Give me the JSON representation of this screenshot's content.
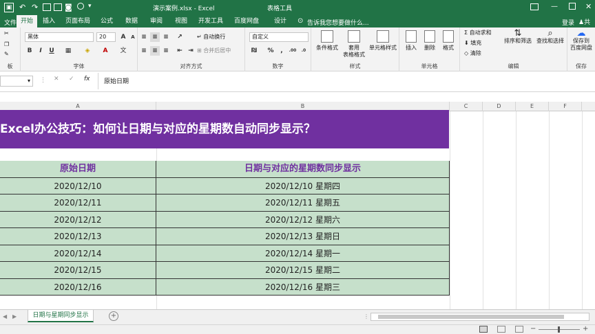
{
  "title_bar": {
    "window_title": "演示案例.xlsx - Excel",
    "context_tab": "表格工具"
  },
  "tabs": {
    "items": [
      "开始",
      "插入",
      "页面布局",
      "公式",
      "数据",
      "审阅",
      "视图",
      "开发工具",
      "百度网盘",
      "设计"
    ],
    "search_placeholder": "告诉我您想要做什么...",
    "login": "登录",
    "share": "共"
  },
  "ribbon": {
    "font_name": "黑体",
    "font_size": "20",
    "number_format": "自定义",
    "wrap_text": "自动换行",
    "merge_center": "合并后居中",
    "conditional_format": "条件格式",
    "table_format": "套用\n表格格式",
    "cell_style": "单元格样式",
    "insert": "插入",
    "delete": "删除",
    "format": "格式",
    "autosum": "自动求和",
    "fill": "填充",
    "clear": "清除",
    "sort_filter": "排序和筛选",
    "find_select": "查找和选择",
    "save_to": "保存到\n百度网盘",
    "groups": [
      "板",
      "字体",
      "对齐方式",
      "数字",
      "样式",
      "单元格",
      "编辑",
      "保存"
    ]
  },
  "formula_bar": {
    "name_box": "",
    "formula": "原始日期"
  },
  "columns": [
    "A",
    "B",
    "C",
    "D",
    "E",
    "F"
  ],
  "sheet": {
    "banner": "Excel办公技巧：如何让日期与对应的星期数自动同步显示？",
    "header_a": "原始日期",
    "header_b": "日期与对应的星期数同步显示",
    "rows": [
      {
        "a": "2020/12/10",
        "b": "2020/12/10  星期四"
      },
      {
        "a": "2020/12/11",
        "b": "2020/12/11  星期五"
      },
      {
        "a": "2020/12/12",
        "b": "2020/12/12  星期六"
      },
      {
        "a": "2020/12/13",
        "b": "2020/12/13  星期日"
      },
      {
        "a": "2020/12/14",
        "b": "2020/12/14  星期一"
      },
      {
        "a": "2020/12/15",
        "b": "2020/12/15  星期二"
      },
      {
        "a": "2020/12/16",
        "b": "2020/12/16  星期三"
      }
    ]
  },
  "sheet_tabs": {
    "active": "日期与星期同步显示"
  },
  "colors": {
    "excel_green": "#217346",
    "banner_purple": "#7030a0",
    "table_green": "#c6e0cb"
  }
}
